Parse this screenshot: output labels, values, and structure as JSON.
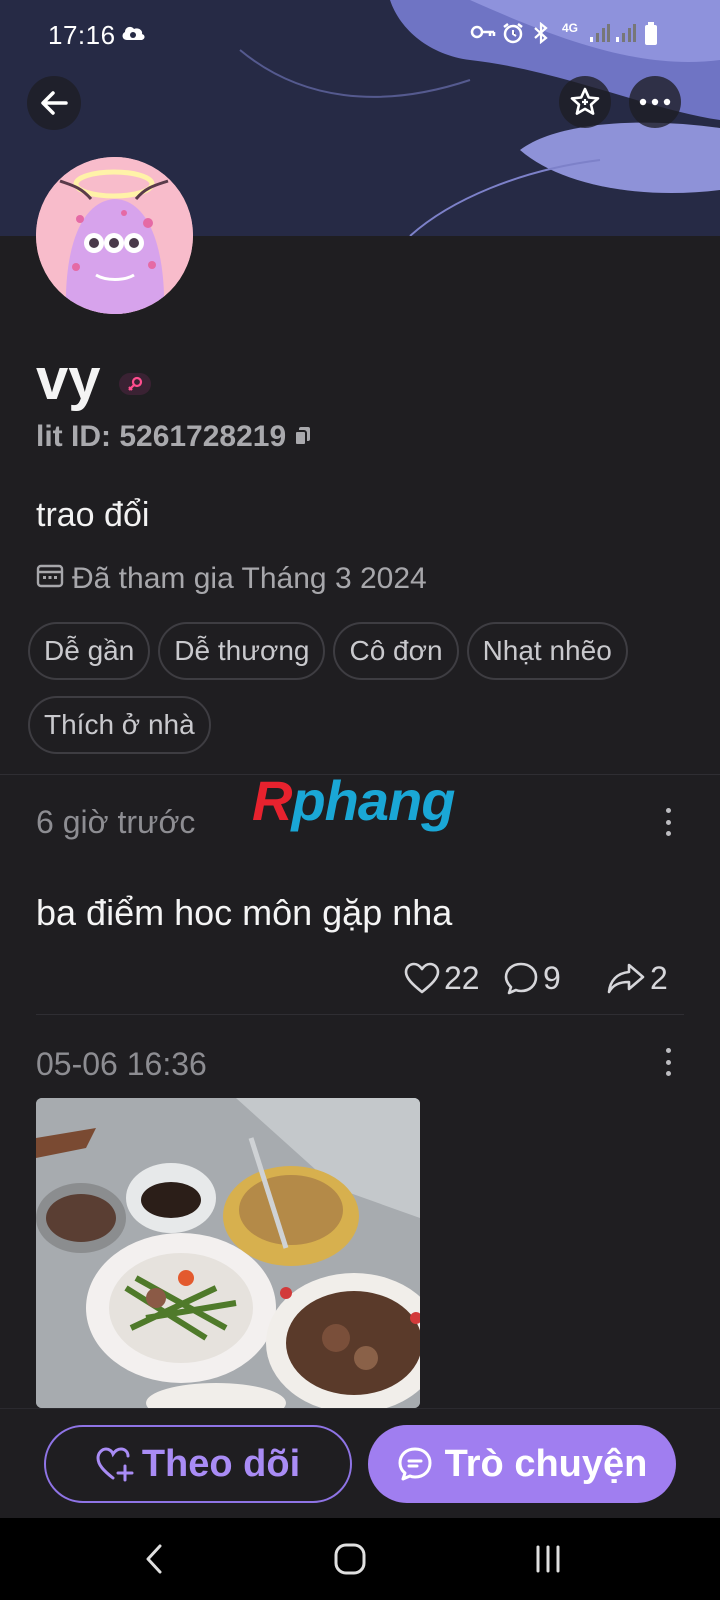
{
  "status_bar": {
    "time": "17:16",
    "network_label": "4G"
  },
  "profile": {
    "username": "vy",
    "lit_id": "lit ID: 5261728219",
    "bio": "trao đổi",
    "joined": "Đã tham gia Tháng 3 2024",
    "tags": [
      "Dễ gần",
      "Dễ thương",
      "Cô đơn",
      "Nhạt nhẽo",
      "Thích ở nhà"
    ]
  },
  "watermark": {
    "first_letter": "R",
    "rest": "phang"
  },
  "posts": [
    {
      "time": "6 giờ trước",
      "text": "ba điểm hoc môn gặp nha",
      "likes": "22",
      "comments": "9",
      "shares": "2"
    },
    {
      "time": "05-06 16:36"
    }
  ],
  "actions": {
    "follow_label": "Theo dõi",
    "chat_label": "Trò chuyện"
  },
  "colors": {
    "accent": "#a07ef0",
    "background": "#1f1e21",
    "banner": "#262a45"
  }
}
